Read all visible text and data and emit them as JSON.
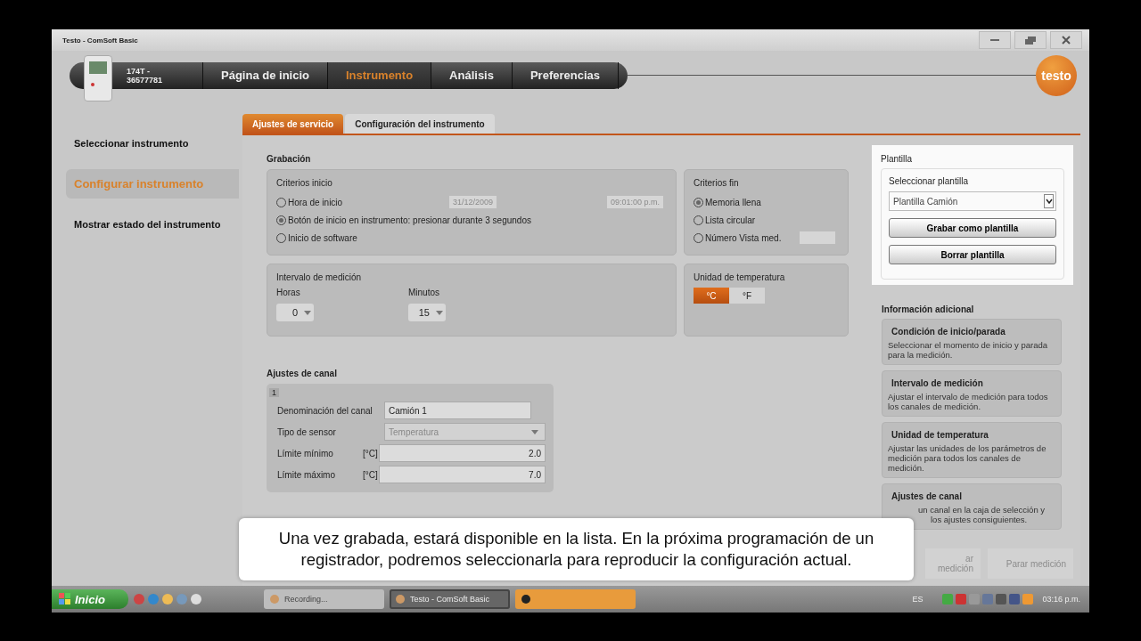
{
  "window": {
    "title": "Testo - ComSoft Basic"
  },
  "nav": {
    "device": [
      "174T -",
      "36577781"
    ],
    "logo": "testo",
    "tabs": [
      {
        "label": "Página de inicio",
        "selected": false
      },
      {
        "label": "Instrumento",
        "selected": true
      },
      {
        "label": "Análisis",
        "selected": false
      },
      {
        "label": "Preferencias",
        "selected": false
      }
    ]
  },
  "sidebar": {
    "items": [
      {
        "label": "Seleccionar instrumento",
        "selected": false
      },
      {
        "label": "Configurar instrumento",
        "selected": true
      },
      {
        "label": "Mostrar estado del instrumento",
        "selected": false
      }
    ]
  },
  "tabs": [
    {
      "label": "Ajustes de servicio",
      "selected": true
    },
    {
      "label": "Configuración del instrumento",
      "selected": false
    }
  ],
  "recording": {
    "heading": "Grabación",
    "start": {
      "title": "Criterios inicio",
      "date": "31/12/2009",
      "time": "09:01:00 p.m.",
      "options": [
        {
          "label": "Hora de inicio",
          "selected": false
        },
        {
          "label": "Botón de inicio en instrumento: presionar durante 3 segundos",
          "selected": true
        },
        {
          "label": "Inicio de software",
          "selected": false
        }
      ]
    },
    "end": {
      "title": "Criterios fin",
      "options": [
        {
          "label": "Memoria llena",
          "selected": true,
          "kind": "plain"
        },
        {
          "label": "Lista circular",
          "selected": false,
          "kind": "plain"
        },
        {
          "label": "Número Vista med.",
          "selected": false,
          "kind": "field"
        }
      ]
    },
    "interval": {
      "title": "Intervalo de medición",
      "hours_label": "Horas",
      "hours": "0",
      "minutes_label": "Minutos",
      "minutes": "15"
    },
    "unit": {
      "title": "Unidad de temperatura",
      "options": [
        {
          "label": "°C",
          "selected": true
        },
        {
          "label": "°F",
          "selected": false
        }
      ]
    }
  },
  "channel": {
    "heading": "Ajustes de canal",
    "number": "1",
    "fields": [
      {
        "label": "Denominación del canal",
        "value": "Camión 1",
        "kind": "text"
      },
      {
        "label": "Tipo de sensor",
        "value": "Temperatura",
        "kind": "select"
      },
      {
        "label": "Límite mínimo",
        "unit": "[°C]",
        "value": "2.0",
        "kind": "number"
      },
      {
        "label": "Límite máximo",
        "unit": "[°C]",
        "value": "7.0",
        "kind": "number"
      }
    ]
  },
  "template": {
    "title": "Plantilla",
    "select_label": "Seleccionar plantilla",
    "value": "Plantilla Camión",
    "buttons": [
      "Grabar como plantilla",
      "Borrar plantilla"
    ]
  },
  "info": {
    "title": "Información adicional",
    "cards": [
      {
        "title": "Condición de inicio/parada",
        "text": "Seleccionar el momento de inicio y parada para la medición.",
        "kind": "full"
      },
      {
        "title": "Intervalo de medición",
        "text": "Ajustar el intervalo de medición para todos los canales de medición.",
        "kind": "full"
      },
      {
        "title": "Unidad de temperatura",
        "text": "Ajustar las unidades de los parámetros de medición para todos los canales de medición.",
        "kind": "full"
      },
      {
        "title": "Ajustes de canal",
        "lines": [
          "un canal en la caja de selección y",
          "los ajustes consiguientes."
        ],
        "kind": "covered"
      }
    ]
  },
  "actions": [
    {
      "label": "ar medición",
      "disabled": true
    },
    {
      "label": "Parar medición",
      "disabled": true
    }
  ],
  "subtitle": [
    "Una vez grabada, estará disponible en la lista. En la próxima programación de un",
    "registrador, podremos seleccionarla para reproducir la configuración actual."
  ],
  "taskbar": {
    "start": "Inicio",
    "tasks": [
      {
        "label": "Recording...",
        "selected": false,
        "flashing": false
      },
      {
        "label": "Testo - ComSoft Basic",
        "selected": true,
        "flashing": false
      },
      {
        "selected": false,
        "flashing": true
      }
    ],
    "language": "ES",
    "clock": "03:16 p.m."
  }
}
